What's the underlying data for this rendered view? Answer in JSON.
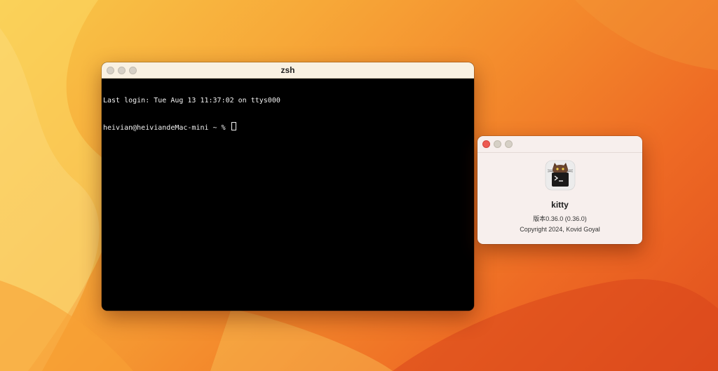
{
  "desktop": {
    "colors": {
      "light": "#f9c94a",
      "mid": "#f3872b",
      "deep": "#e14f1e"
    }
  },
  "terminal": {
    "title": "zsh",
    "lines": [
      "Last login: Tue Aug 13 11:37:02 on ttys000",
      "heivian@heiviandeMac-mini ~ % "
    ],
    "background": "#000000",
    "foreground": "#f2f2f2"
  },
  "about": {
    "app_name": "kitty",
    "version": "版本0.36.0 (0.36.0)",
    "copyright": "Copyright 2024, Kovid Goyal",
    "icon": "kitty-cat-terminal-icon"
  }
}
